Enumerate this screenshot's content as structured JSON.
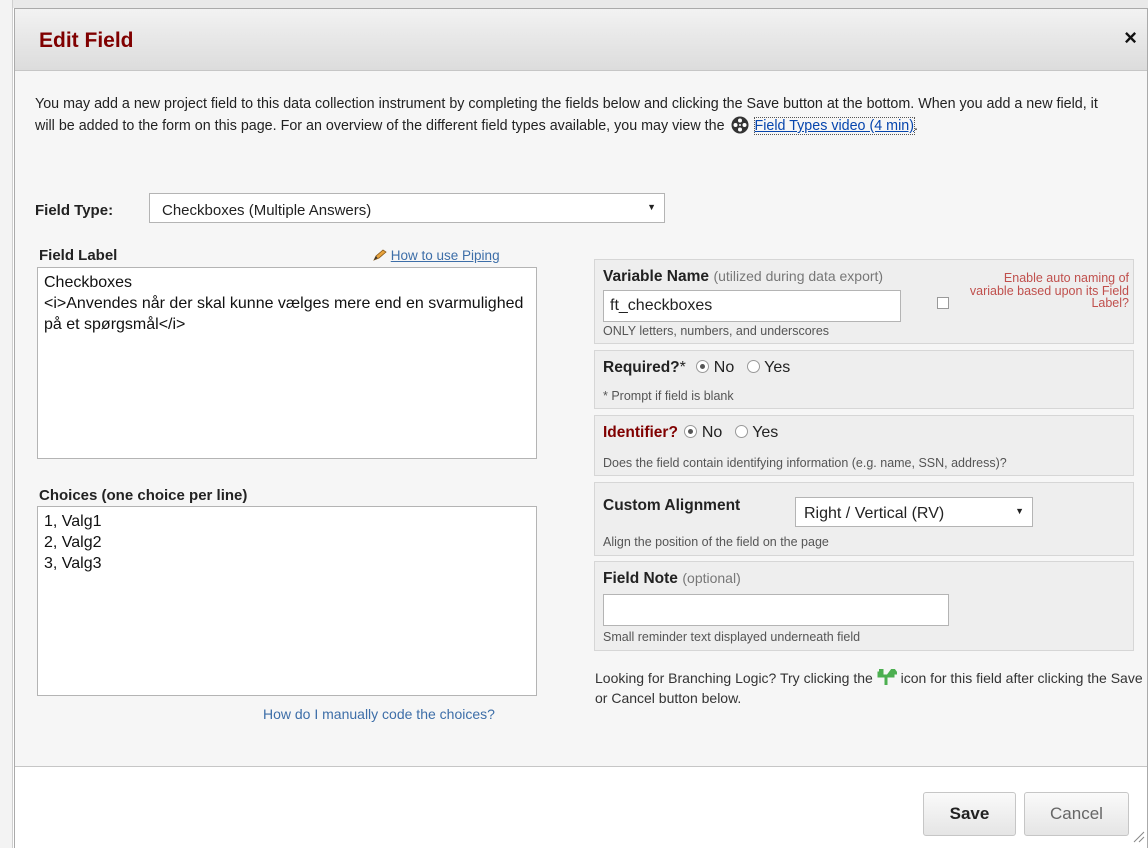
{
  "dialog": {
    "title": "Edit Field",
    "close_glyph": "×",
    "intro_text": "You may add a new project field to this data collection instrument by completing the fields below and clicking the Save button at the bottom. When you add a new field, it will be added to the form on this page. For an overview of the different field types available, you may view the",
    "intro_link": "Field Types video (4 min)",
    "intro_end": "."
  },
  "field_type": {
    "label": "Field Type:",
    "selected": "Checkboxes (Multiple Answers)"
  },
  "field_label": {
    "title": "Field Label",
    "piping_link": "How to use Piping",
    "value": "Checkboxes\n<i>Anvendes når der skal kunne vælges mere end en svarmulighed på et spørgsmål</i>"
  },
  "choices": {
    "title": "Choices (one choice per line)",
    "value": "1, Valg1\n2, Valg2\n3, Valg3",
    "help_link": "How do I manually code the choices?"
  },
  "variable_name": {
    "label": "Variable Name",
    "hint": "(utilized during data export)",
    "value": "ft_checkboxes",
    "note": "ONLY letters, numbers, and underscores",
    "auto_naming": "Enable auto naming of variable based upon its Field Label?"
  },
  "required": {
    "label": "Required?",
    "asterisk": "*",
    "option_no": "No",
    "option_yes": "Yes",
    "note": "* Prompt if field is blank"
  },
  "identifier": {
    "label": "Identifier?",
    "option_no": "No",
    "option_yes": "Yes",
    "note": "Does the field contain identifying information (e.g. name, SSN, address)?"
  },
  "alignment": {
    "label": "Custom Alignment",
    "selected": "Right / Vertical (RV)",
    "note": "Align the position of the field on the page"
  },
  "field_note": {
    "label": "Field Note",
    "hint": "(optional)",
    "value": "",
    "note": "Small reminder text displayed underneath field"
  },
  "branching": {
    "text_before": "Looking for Branching Logic? Try clicking the",
    "text_after": "icon for this field after clicking the Save or Cancel button below."
  },
  "buttons": {
    "save": "Save",
    "cancel": "Cancel"
  },
  "colors": {
    "title": "#800000",
    "link": "#3d6ea8",
    "auto_naming": "#c0504d",
    "branch_icon": "#4caf50"
  },
  "icons": [
    "close-icon",
    "film-reel-icon",
    "pencil-icon",
    "dropdown-arrow-icon",
    "branching-arrow-icon",
    "resize-grip-icon"
  ]
}
